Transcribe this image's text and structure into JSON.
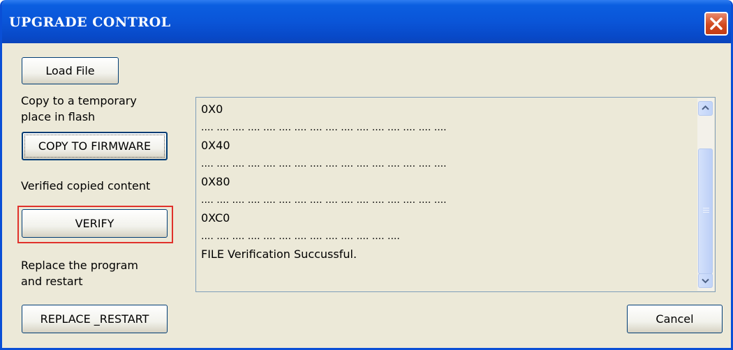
{
  "window": {
    "title": "UPGRADE CONTROL"
  },
  "buttons": {
    "load_file": "Load File",
    "copy_to_firmware": "COPY TO FIRMWARE",
    "verify": "VERIFY",
    "replace_restart": "REPLACE _RESTART",
    "cancel": "Cancel"
  },
  "labels": {
    "copy_line1": "Copy to a temporary",
    "copy_line2": "place in flash",
    "verify": "Verified copied content",
    "replace_line1": "Replace the program",
    "replace_line2": "and restart"
  },
  "log": {
    "lines": [
      "0X0",
      ".... .... .... .... .... .... .... .... .... .... .... .... .... .... .... ....",
      "0X40",
      ".... .... .... .... .... .... .... .... .... .... .... .... .... .... .... ....",
      "0X80",
      ".... .... .... .... .... .... .... .... .... .... .... .... .... .... .... ....",
      "0XC0",
      ".... .... .... .... .... .... .... .... .... .... .... .... ....",
      "FILE Verification Succussful."
    ]
  },
  "icons": {
    "close": "close-icon",
    "scroll_up": "chevron-up-icon",
    "scroll_down": "chevron-down-icon"
  },
  "colors": {
    "titlebar": "#0a55d8",
    "close_button": "#d2491f",
    "dialog_background": "#ece9d8",
    "highlight_border": "#e0312b"
  }
}
